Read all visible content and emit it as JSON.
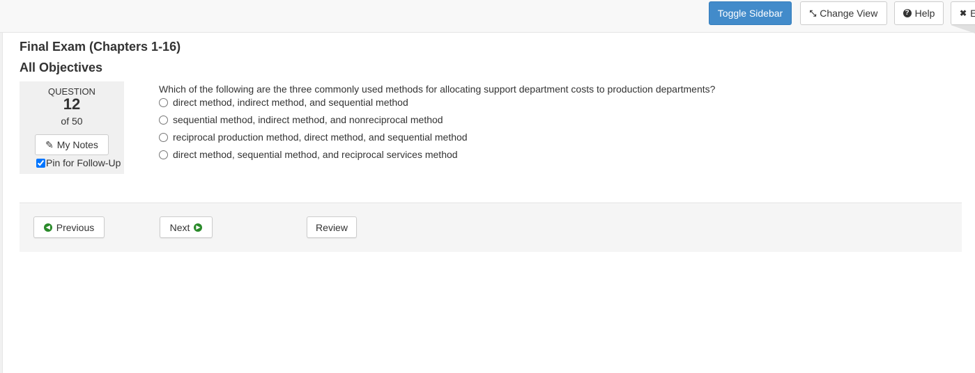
{
  "toolbar": {
    "toggle_sidebar": "Toggle Sidebar",
    "change_view": "Change View",
    "help": "Help",
    "exit": "E",
    "primary_color": "#428bca"
  },
  "exam": {
    "title": "Final Exam (Chapters 1-16)",
    "objectives": "All Objectives"
  },
  "question_panel": {
    "label": "QUESTION",
    "number": "12",
    "of_total": "of 50",
    "notes_label": "My Notes",
    "pin_label": "Pin for Follow-Up",
    "pin_checked": true
  },
  "question": {
    "text": "Which of the following are the three commonly used methods for allocating support department costs to production departments?",
    "choices": [
      "direct method, indirect method, and sequential method",
      "sequential method, indirect method, and nonreciprocal method",
      "reciprocal production method, direct method, and sequential method",
      "direct method, sequential method, and reciprocal services method"
    ]
  },
  "navigation": {
    "previous": "Previous",
    "next": "Next",
    "review": "Review",
    "arrow_color": "#2a8a2a"
  },
  "icons": {
    "change_view": "compress-arrows-icon",
    "help": "question-circle-icon",
    "exit": "close-icon",
    "notes": "edit-note-icon",
    "previous": "arrow-circle-left-icon",
    "next": "arrow-circle-right-icon"
  }
}
